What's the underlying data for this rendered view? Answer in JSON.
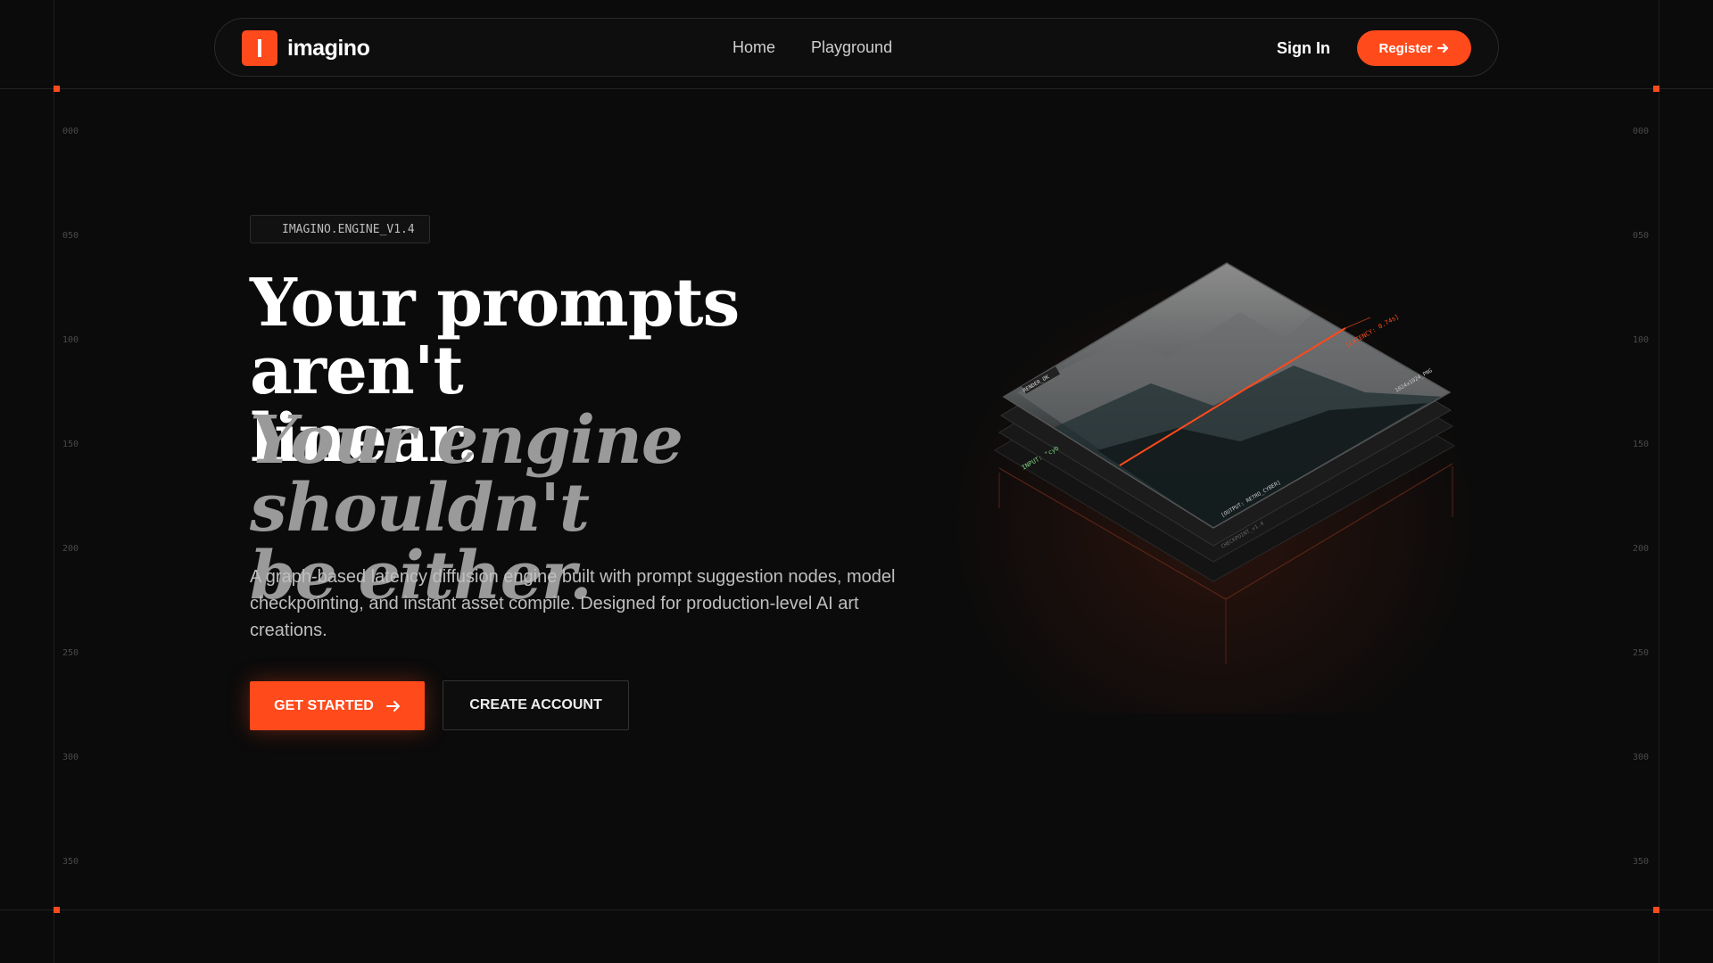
{
  "nav": {
    "brand": "imagino",
    "links": [
      "Home",
      "Playground"
    ],
    "sign_in": "Sign In",
    "register": "Register"
  },
  "ruler": {
    "left": [
      "000",
      "050",
      "100",
      "150",
      "200",
      "250",
      "300",
      "350"
    ],
    "right": [
      "000",
      "050",
      "100",
      "150",
      "200",
      "250",
      "300",
      "350"
    ]
  },
  "hero": {
    "badge": "IMAGINO.ENGINE_V1.4",
    "headline_line1": "Your prompts aren't",
    "headline_line2": "linear.",
    "headline_italic_line1": "Your engine shouldn't",
    "headline_italic_line2": "be either.",
    "description": "A graph-based latency diffusion engine built with prompt suggestion nodes, model checkpointing, and instant asset compile. Designed for production-level AI art creations.",
    "primary_button": "GET STARTED",
    "secondary_button": "CREATE ACCOUNT"
  },
  "illustration": {
    "render_tag": "RENDER_OK",
    "latency_tag": "[LATENCY: 0.74s]",
    "resolution_tag": "1024x1024_PNG",
    "output_tag": "[OUTPUT: RETRO_CYBER]",
    "checkpoint_tag": "CHECKPOINT_v1.4",
    "input_tag": "INPUT: \"cyb"
  },
  "colors": {
    "accent": "#ff4a1c",
    "background": "#0b0b0b"
  }
}
